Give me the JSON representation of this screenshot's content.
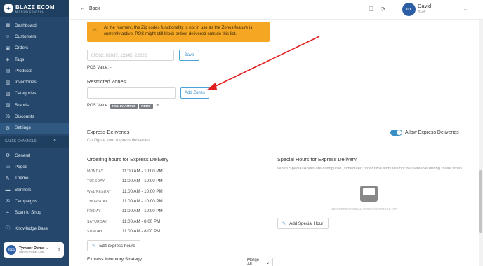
{
  "brand": {
    "name": "BLAZE ECOM",
    "sub": "MISSION CONTROL"
  },
  "sidebar": {
    "items": [
      {
        "label": "Dashboard",
        "icon": "dashboard-icon"
      },
      {
        "label": "Customers",
        "icon": "customers-icon"
      },
      {
        "label": "Orders",
        "icon": "orders-icon"
      },
      {
        "label": "Tags",
        "icon": "tag-icon"
      },
      {
        "label": "Products",
        "icon": "products-icon"
      },
      {
        "label": "Inventories",
        "icon": "inventory-icon"
      },
      {
        "label": "Categories",
        "icon": "categories-icon"
      },
      {
        "label": "Brands",
        "icon": "brands-icon"
      },
      {
        "label": "Discounts",
        "icon": "discount-icon"
      },
      {
        "label": "Settings",
        "icon": "gear-icon",
        "active": true
      }
    ],
    "section_label": "SALES CHANNELS",
    "channel_items": [
      {
        "label": "General",
        "icon": "gear-icon"
      },
      {
        "label": "Pages",
        "icon": "pages-icon"
      },
      {
        "label": "Theme",
        "icon": "theme-icon"
      },
      {
        "label": "Banners",
        "icon": "banner-icon"
      },
      {
        "label": "Campaigns",
        "icon": "campaign-icon"
      },
      {
        "label": "Scan to Shop",
        "icon": "scan-icon"
      }
    ],
    "knowledge_base": "Knowledge Base",
    "store": {
      "avatar": "TDD1",
      "name": "Tymber Demo ...",
      "sub": "Delivery, Pickup, Kiosk"
    }
  },
  "topbar": {
    "back_label": "Back",
    "user": {
      "initials": "DT",
      "name": "David",
      "role": "Staff"
    }
  },
  "main": {
    "warning": "At the moment, the Zip codes functionality is not in use as the Zones feature is currently active. POS might still block orders delivered outside this list.",
    "zip_placeholder": "89502, 92037, 12345, 22222",
    "save_label": "Save",
    "pos_value_label": "POS Value:",
    "pos_value_empty": "-",
    "restricted_zones_title": "Restricted Zones",
    "add_zones_label": "Add Zones",
    "zone_tags": [
      "KML EXAMPLE",
      "RENO"
    ],
    "express": {
      "title": "Express Deliveries",
      "subtitle": "Configure your express deliveries.",
      "allow_label": "Allow Express Deliveries",
      "allow_enabled": true
    },
    "ordering_hours": {
      "title": "Ordering hours for Express Delivery",
      "rows": [
        {
          "day": "MONDAY",
          "time": "11:00 AM - 10:00 PM"
        },
        {
          "day": "TUESDAY",
          "time": "11:00 AM - 10:00 PM"
        },
        {
          "day": "WEDNESDAY",
          "time": "11:00 AM - 10:00 PM"
        },
        {
          "day": "THURSDAY",
          "time": "11:00 AM - 10:00 PM"
        },
        {
          "day": "FRIDAY",
          "time": "11:00 AM - 10:00 PM"
        },
        {
          "day": "SATURDAY",
          "time": "11:00 AM - 8:00 PM"
        },
        {
          "day": "SUNDAY",
          "time": "11:00 AM - 8:00 PM"
        }
      ],
      "edit_label": "Edit express hours"
    },
    "special_hours": {
      "title": "Special Hours for Express Delivery",
      "note": "When Special Hours are configured, scheduled order time slots will not be available during those times.",
      "empty_label": "NO STORE/SPECIAL-HOURS/EXPRESS YET",
      "add_label": "Add Special Hour"
    },
    "inventory_strategy": {
      "title": "Express Inventory Strategy",
      "select_value": "Merge All"
    }
  },
  "colors": {
    "sidebar": "#24476b",
    "warning": "#f5a623",
    "accent": "#3a8fc6",
    "arrow": "#e02020"
  }
}
